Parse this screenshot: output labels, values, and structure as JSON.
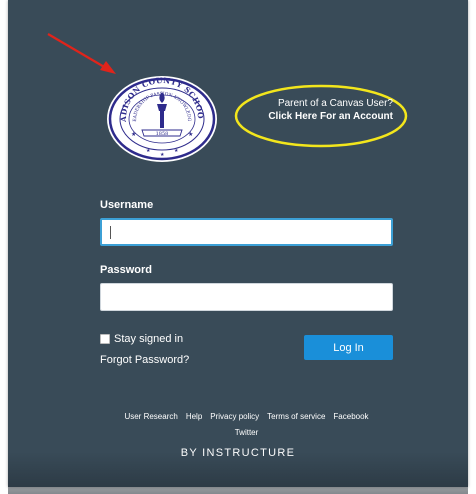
{
  "seal": {
    "text_top": "MADISON COUNTY SCHOOLS",
    "text_inner": "LEADERSHIP PASSION KNOWLEDGE",
    "year": "1858"
  },
  "parent_link": {
    "line1": "Parent of a Canvas User?",
    "line2": "Click Here For an Account"
  },
  "form": {
    "username_label": "Username",
    "username_value": "",
    "password_label": "Password",
    "password_value": "",
    "stay_signed_in": "Stay signed in",
    "forgot_password": "Forgot Password?",
    "login_label": "Log In"
  },
  "footer": {
    "links": [
      "User Research",
      "Help",
      "Privacy policy",
      "Terms of service",
      "Facebook",
      "Twitter"
    ],
    "by_line": "BY INSTRUCTURE"
  },
  "colors": {
    "panel": "#394b58",
    "login_button": "#1a8fd9",
    "focus_border": "#3ca0d6",
    "annotation_arrow": "#e0241b",
    "annotation_oval": "#f3e61c"
  }
}
